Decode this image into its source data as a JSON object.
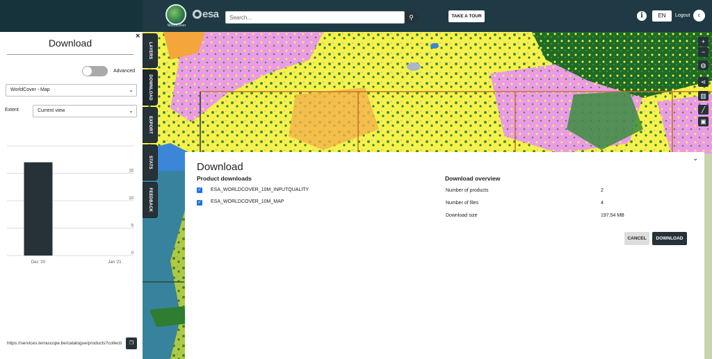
{
  "header": {
    "logo_caption": "WorldCover",
    "esa_text": "esa",
    "search_placeholder": "Search...",
    "search_icon": "search-icon",
    "take_tour_label": "TAKE A TOUR",
    "info_icon": "info-icon",
    "language": "EN",
    "logout_label": "Logout",
    "avatar_initial": "c"
  },
  "left_panel": {
    "close_label": "×",
    "title": "Download",
    "advanced_label": "Advanced",
    "advanced_enabled": false,
    "layer_select": {
      "value": "WorldCover - Map"
    },
    "extent_label": "Extent",
    "extent_select": {
      "value": "Current view"
    },
    "url": "https://services.terrascope.be/catalogue/products?collectionId",
    "copy_icon": "copy-icon"
  },
  "tabs": [
    {
      "label": "LAYERS"
    },
    {
      "label": "DOWNLOAD"
    },
    {
      "label": "EXPORT"
    },
    {
      "label": "STATS"
    },
    {
      "label": "FEEDBACK"
    }
  ],
  "map_controls": [
    {
      "icon": "zoom-in-icon",
      "glyph": "+"
    },
    {
      "icon": "zoom-out-icon",
      "glyph": "−"
    },
    {
      "icon": "globe-icon",
      "glyph": "◍"
    },
    {
      "icon": "share-icon",
      "glyph": "⋖"
    },
    {
      "icon": "map-icon",
      "glyph": "▥"
    },
    {
      "icon": "ruler-icon",
      "glyph": "╱"
    },
    {
      "icon": "fullscreen-icon",
      "glyph": "▣"
    }
  ],
  "dialog": {
    "title": "Download",
    "collapse_icon": "chevron-down-icon",
    "product_downloads_label": "Product downloads",
    "products": [
      {
        "name": "ESA_WORLDCOVER_10M_INPUTQUALITY",
        "checked": true
      },
      {
        "name": "ESA_WORLDCOVER_10M_MAP",
        "checked": true
      }
    ],
    "overview_label": "Download overview",
    "overview": [
      {
        "label": "Number of products",
        "value": "2"
      },
      {
        "label": "Number of files",
        "value": "4"
      },
      {
        "label": "Download size",
        "value": "197.54 MB"
      }
    ],
    "cancel_label": "CANCEL",
    "download_label": "DOWNLOAD"
  },
  "chart_data": {
    "type": "bar",
    "categories": [
      "Dec '20",
      "Jan '21"
    ],
    "values": [
      17,
      0
    ],
    "yticks": [
      0,
      5,
      10,
      15
    ],
    "ylim": [
      0,
      20
    ],
    "color": "#263238",
    "grid": true
  }
}
